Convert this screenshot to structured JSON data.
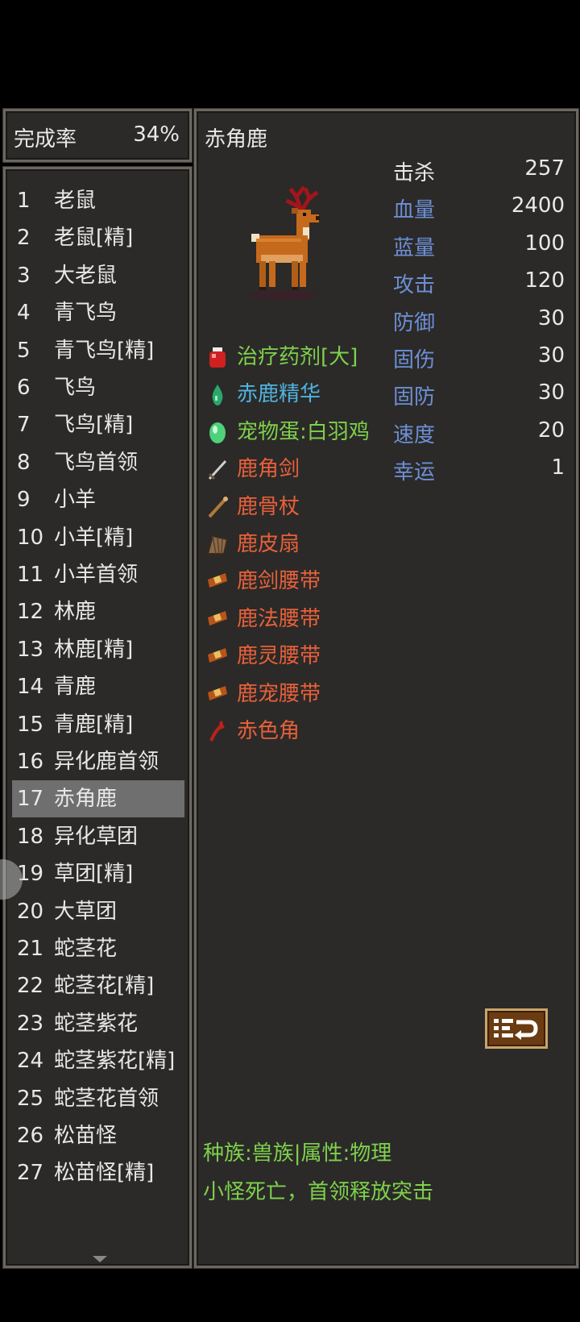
{
  "header": {
    "completion_label": "完成率",
    "completion_value": "34%"
  },
  "list": {
    "selected_index": 16,
    "items": [
      {
        "num": "1",
        "name": "老鼠"
      },
      {
        "num": "2",
        "name": "老鼠[精]"
      },
      {
        "num": "3",
        "name": "大老鼠"
      },
      {
        "num": "4",
        "name": "青飞鸟"
      },
      {
        "num": "5",
        "name": "青飞鸟[精]"
      },
      {
        "num": "6",
        "name": "飞鸟"
      },
      {
        "num": "7",
        "name": "飞鸟[精]"
      },
      {
        "num": "8",
        "name": "飞鸟首领"
      },
      {
        "num": "9",
        "name": "小羊"
      },
      {
        "num": "10",
        "name": "小羊[精]"
      },
      {
        "num": "11",
        "name": "小羊首领"
      },
      {
        "num": "12",
        "name": "林鹿"
      },
      {
        "num": "13",
        "name": "林鹿[精]"
      },
      {
        "num": "14",
        "name": "青鹿"
      },
      {
        "num": "15",
        "name": "青鹿[精]"
      },
      {
        "num": "16",
        "name": "异化鹿首领"
      },
      {
        "num": "17",
        "name": "赤角鹿"
      },
      {
        "num": "18",
        "name": "异化草团"
      },
      {
        "num": "19",
        "name": "草团[精]"
      },
      {
        "num": "20",
        "name": "大草团"
      },
      {
        "num": "21",
        "name": "蛇茎花"
      },
      {
        "num": "22",
        "name": "蛇茎花[精]"
      },
      {
        "num": "23",
        "name": "蛇茎紫花"
      },
      {
        "num": "24",
        "name": "蛇茎紫花[精]"
      },
      {
        "num": "25",
        "name": "蛇茎花首领"
      },
      {
        "num": "26",
        "name": "松苗怪"
      },
      {
        "num": "27",
        "name": "松苗怪[精]"
      }
    ]
  },
  "detail": {
    "title": "赤角鹿",
    "stats": [
      {
        "label": "击杀",
        "value": "257",
        "color": "#e8e8e8"
      },
      {
        "label": "血量",
        "value": "2400",
        "color": "#6d8fd6"
      },
      {
        "label": "蓝量",
        "value": "100",
        "color": "#6d8fd6"
      },
      {
        "label": "攻击",
        "value": "120",
        "color": "#6d8fd6"
      },
      {
        "label": "防御",
        "value": "30",
        "color": "#6d8fd6"
      },
      {
        "label": "固伤",
        "value": "30",
        "color": "#6d8fd6"
      },
      {
        "label": "固防",
        "value": "30",
        "color": "#6d8fd6"
      },
      {
        "label": "速度",
        "value": "20",
        "color": "#6d8fd6"
      },
      {
        "label": "幸运",
        "value": "1",
        "color": "#6d8fd6"
      }
    ],
    "drops": [
      {
        "name": "治疗药剂[大]",
        "color": "#7ed14c",
        "icon": "potion-icon"
      },
      {
        "name": "赤鹿精华",
        "color": "#4fb3e0",
        "icon": "essence-drop-icon"
      },
      {
        "name": "宠物蛋:白羽鸡",
        "color": "#7ed14c",
        "icon": "pet-egg-icon"
      },
      {
        "name": "鹿角剑",
        "color": "#e8603a",
        "icon": "sword-icon"
      },
      {
        "name": "鹿骨杖",
        "color": "#e8603a",
        "icon": "staff-icon"
      },
      {
        "name": "鹿皮扇",
        "color": "#e8603a",
        "icon": "fan-icon"
      },
      {
        "name": "鹿剑腰带",
        "color": "#e8603a",
        "icon": "belt-icon"
      },
      {
        "name": "鹿法腰带",
        "color": "#e8603a",
        "icon": "belt-icon"
      },
      {
        "name": "鹿灵腰带",
        "color": "#e8603a",
        "icon": "belt-icon"
      },
      {
        "name": "鹿宠腰带",
        "color": "#e8603a",
        "icon": "belt-icon"
      },
      {
        "name": "赤色角",
        "color": "#e8603a",
        "icon": "red-horn-icon"
      }
    ],
    "footer_line1": "种族:兽族|属性:物理",
    "footer_line2": "小怪死亡，首领释放突击",
    "action_icon": "list-swap-icon"
  }
}
